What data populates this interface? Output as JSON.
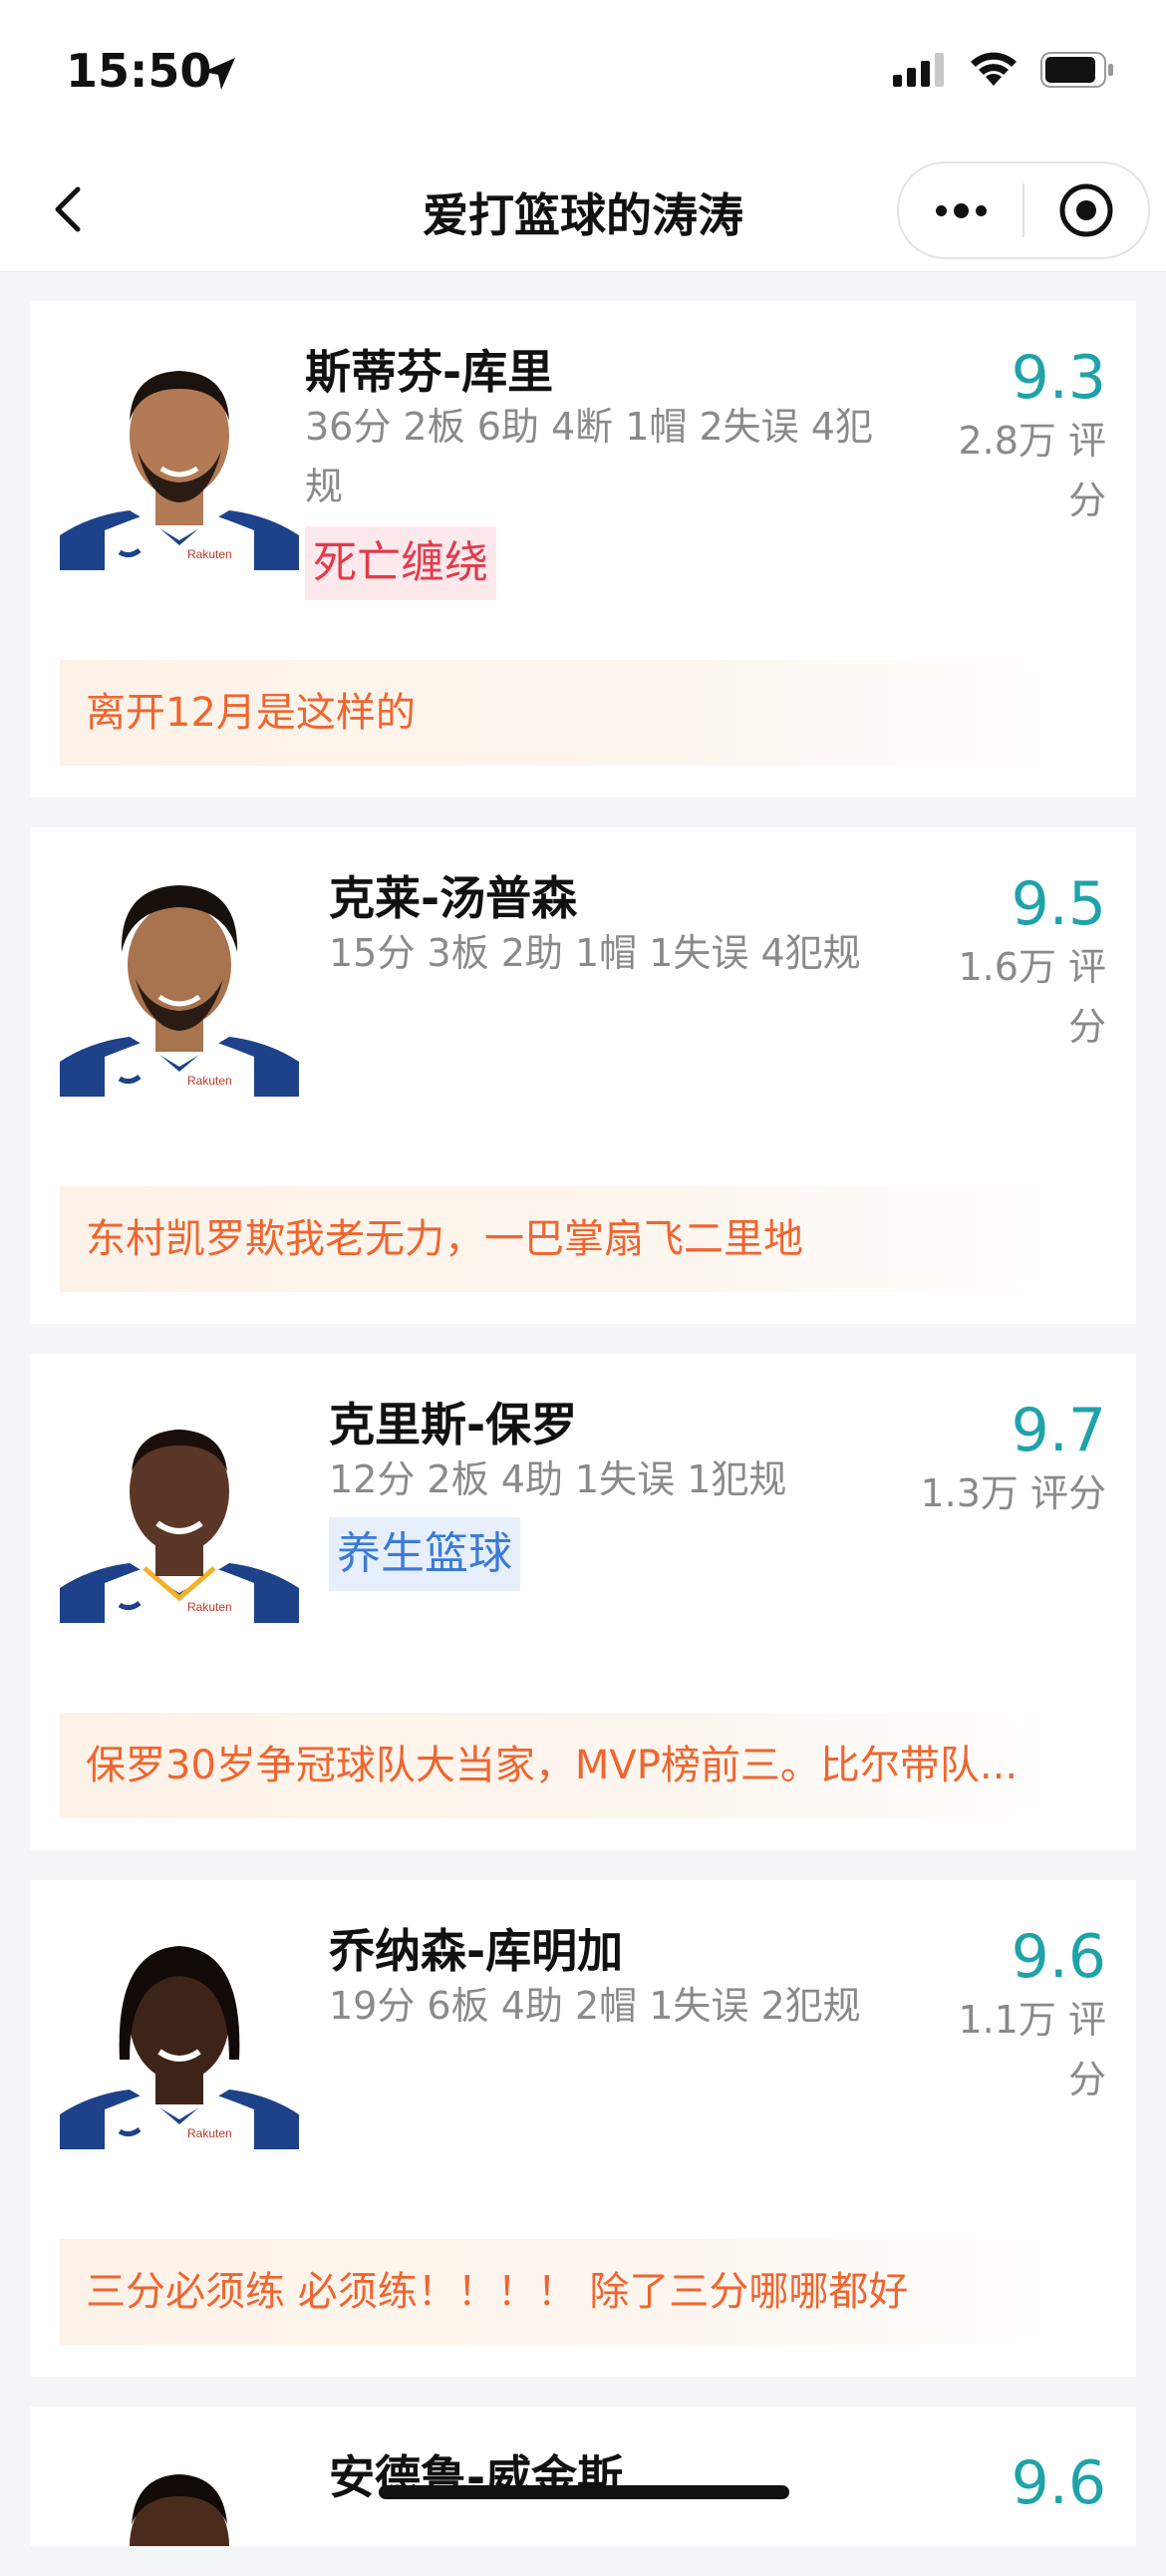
{
  "status": {
    "time": "15:50"
  },
  "nav": {
    "title": "爱打篮球的涛涛"
  },
  "players": [
    {
      "name": "斯蒂芬-库里",
      "stats": "36分 2板 6助 4断 1帽 2失误 4犯规",
      "tag": "死亡缠绕",
      "tag_color": "red",
      "score": "9.3",
      "rating": "2.8万 评分",
      "comment": "离开12月是这样的",
      "jersey_color": "#1d428a",
      "skin": "#b27a55"
    },
    {
      "name": "克莱-汤普森",
      "stats": "15分 3板 2助 1帽 1失误 4犯规",
      "tag": "",
      "score": "9.5",
      "rating": "1.6万 评分",
      "comment": "东村凯罗欺我老无力，一巴掌扇飞二里地",
      "jersey_color": "#1d428a",
      "skin": "#a8734f"
    },
    {
      "name": "克里斯-保罗",
      "stats": "12分 2板 4助 1失误 1犯规",
      "tag": "养生篮球",
      "tag_color": "blue",
      "score": "9.7",
      "rating": "1.3万 评分",
      "comment": "保罗30岁争冠球队大当家，MVP榜前三。比尔带队...",
      "jersey_color": "#1d428a",
      "skin": "#5a3726"
    },
    {
      "name": "乔纳森-库明加",
      "stats": "19分 6板 4助 2帽 1失误 2犯规",
      "tag": "",
      "score": "9.6",
      "rating": "1.1万 评分",
      "comment": "三分必须练 必须练！！！！ 除了三分哪哪都好",
      "jersey_color": "#1d428a",
      "skin": "#3e2418"
    },
    {
      "name": "安德鲁-威金斯",
      "stats": "",
      "score": "9.6",
      "skin": "#4a2c1d"
    }
  ],
  "colors": {
    "accent": "#1fa3a8",
    "comment": "#f0652f"
  }
}
